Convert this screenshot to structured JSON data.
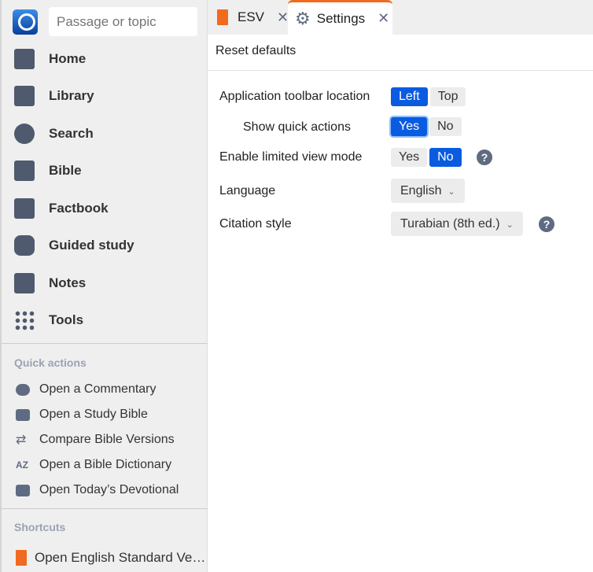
{
  "search": {
    "placeholder": "Passage or topic"
  },
  "nav": [
    {
      "label": "Home",
      "icon": "home-icon"
    },
    {
      "label": "Library",
      "icon": "library-icon"
    },
    {
      "label": "Search",
      "icon": "search-icon"
    },
    {
      "label": "Bible",
      "icon": "bible-icon"
    },
    {
      "label": "Factbook",
      "icon": "factbook-icon"
    },
    {
      "label": "Guided study",
      "icon": "guided-study-icon"
    },
    {
      "label": "Notes",
      "icon": "notes-icon"
    },
    {
      "label": "Tools",
      "icon": "tools-icon"
    }
  ],
  "quick_actions": {
    "title": "Quick actions",
    "items": [
      {
        "label": "Open a Commentary"
      },
      {
        "label": "Open a Study Bible"
      },
      {
        "label": "Compare Bible Versions"
      },
      {
        "label": "Open a Bible Dictionary"
      },
      {
        "label": "Open Today’s Devotional"
      }
    ]
  },
  "shortcuts": {
    "title": "Shortcuts",
    "items": [
      {
        "label": "Open English Standard Ve…"
      }
    ]
  },
  "tabs": [
    {
      "label": "ESV",
      "close": "✕"
    },
    {
      "label": "Settings",
      "close": "✕"
    }
  ],
  "settings": {
    "reset": "Reset defaults",
    "toolbar": {
      "label": "Application toolbar location",
      "options": [
        "Left",
        "Top"
      ],
      "selected": "Left"
    },
    "quick": {
      "label": "Show quick actions",
      "options": [
        "Yes",
        "No"
      ],
      "selected": "Yes"
    },
    "limited": {
      "label": "Enable limited view mode",
      "options": [
        "Yes",
        "No"
      ],
      "selected": "No",
      "help": "?"
    },
    "language": {
      "label": "Language",
      "value": "English"
    },
    "citation": {
      "label": "Citation style",
      "value": "Turabian (8th ed.)",
      "help": "?"
    }
  },
  "colors": {
    "accent": "#0a5be0",
    "tab_indicator": "#f26a1b"
  }
}
